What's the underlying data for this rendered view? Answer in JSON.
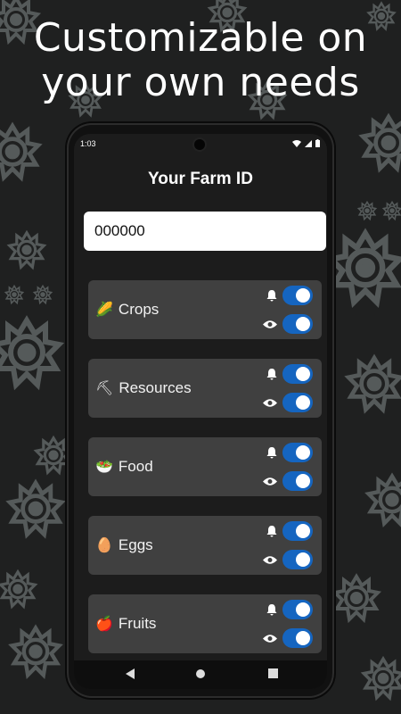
{
  "headline": {
    "line1": "Customizable on",
    "line2": "your own needs"
  },
  "status_bar": {
    "time": "1:03"
  },
  "app": {
    "title": "Your Farm ID",
    "farm_id_value": "000000"
  },
  "categories": [
    {
      "emoji": "🌽",
      "label": "Crops",
      "notify_on": true,
      "visible_on": true
    },
    {
      "emoji": "⛏",
      "label": "Resources",
      "notify_on": true,
      "visible_on": true
    },
    {
      "emoji": "🥗",
      "label": "Food",
      "notify_on": true,
      "visible_on": true
    },
    {
      "emoji": "🥚",
      "label": "Eggs",
      "notify_on": true,
      "visible_on": true
    },
    {
      "emoji": "🍎",
      "label": "Fruits",
      "notify_on": true,
      "visible_on": true
    }
  ],
  "colors": {
    "accent": "#1565c0",
    "card": "#404040",
    "background": "#1f2020"
  },
  "icons": {
    "notify": "bell-icon",
    "visible": "eye-icon"
  }
}
